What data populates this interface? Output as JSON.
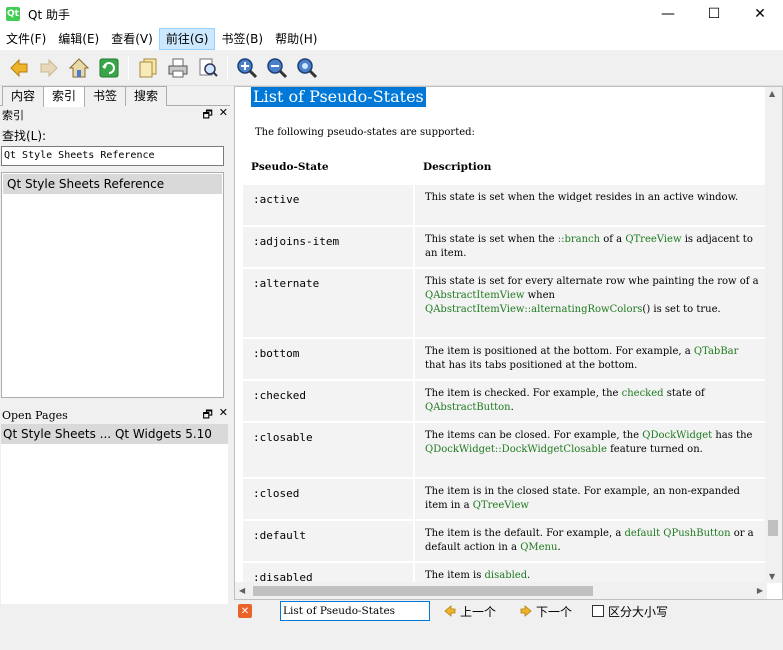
{
  "window": {
    "title": "Qt 助手",
    "icon_text": "Qt",
    "minimize": "—",
    "maximize": "☐",
    "close": "✕"
  },
  "menu": [
    "文件(F)",
    "编辑(E)",
    "查看(V)",
    "前往(G)",
    "书签(B)",
    "帮助(H)"
  ],
  "toolbar_icons": [
    "back-icon",
    "forward-icon",
    "home-icon",
    "sync-icon",
    "copy-icon",
    "print-icon",
    "find-icon",
    "zoom-in-icon",
    "zoom-out-icon",
    "zoom-reset-icon"
  ],
  "left": {
    "tabs": [
      "内容",
      "索引",
      "书签",
      "搜索"
    ],
    "index_dock_title": "索引",
    "find_label": "查找(L):",
    "find_value": "Qt Style Sheets Reference",
    "index_items": [
      "Qt Style Sheets Reference"
    ],
    "open_pages_title": "Open Pages",
    "open_pages": [
      "Qt Style Sheets ... Qt Widgets 5.10"
    ],
    "float_icon": "🗗",
    "close_icon": "✕"
  },
  "doc": {
    "title": "List of Pseudo-States",
    "intro": "The following pseudo-states are supported:",
    "col_state": "Pseudo-State",
    "col_desc": "Description",
    "rows": [
      {
        "name": ":active",
        "desc": "This state is set when the widget resides in an active window."
      },
      {
        "name": ":adjoins-item",
        "d1": "This state is set when the ",
        "l1": "::branch",
        "d2": " of a ",
        "l2": "QTreeView",
        "d3": " is adjacent to an item."
      },
      {
        "name": ":alternate",
        "d1": "This state is set for every alternate row whe painting the row of a ",
        "l1": "QAbstractItemView",
        "d2": " when ",
        "l2": "QAbstractItemView::alternatingRowColors",
        "d3": "() is set to true."
      },
      {
        "name": ":bottom",
        "d1": "The item is positioned at the bottom. For example, a ",
        "l1": "QTabBar",
        "d2": " that has its tabs positioned at the bottom."
      },
      {
        "name": ":checked",
        "d1": "The item is checked. For example, the ",
        "l1": "checked",
        "d2": " state of ",
        "l2": "QAbstractButton",
        "d3": "."
      },
      {
        "name": ":closable",
        "d1": "The items can be closed. For example, the ",
        "l1": "QDockWidget",
        "d2": " has the ",
        "l2": "QDockWidget::DockWidgetClosable",
        "d3": " feature turned on."
      },
      {
        "name": ":closed",
        "d1": "The item is in the closed state. For example, an non-expanded item in a ",
        "l1": "QTreeView",
        "d2": ""
      },
      {
        "name": ":default",
        "d1": "The item is the default. For example, a ",
        "l1": "default",
        "d2": " ",
        "l2": "QPushButton",
        "d3": " or a default action in a ",
        "l3": "QMenu",
        "d4": "."
      },
      {
        "name": ":disabled",
        "d1": "The item is ",
        "l1": "disabled",
        "d2": "."
      }
    ]
  },
  "findbar": {
    "value": "List of Pseudo-States",
    "prev": "上一个",
    "next": "下一个",
    "case": "区分大小写"
  }
}
